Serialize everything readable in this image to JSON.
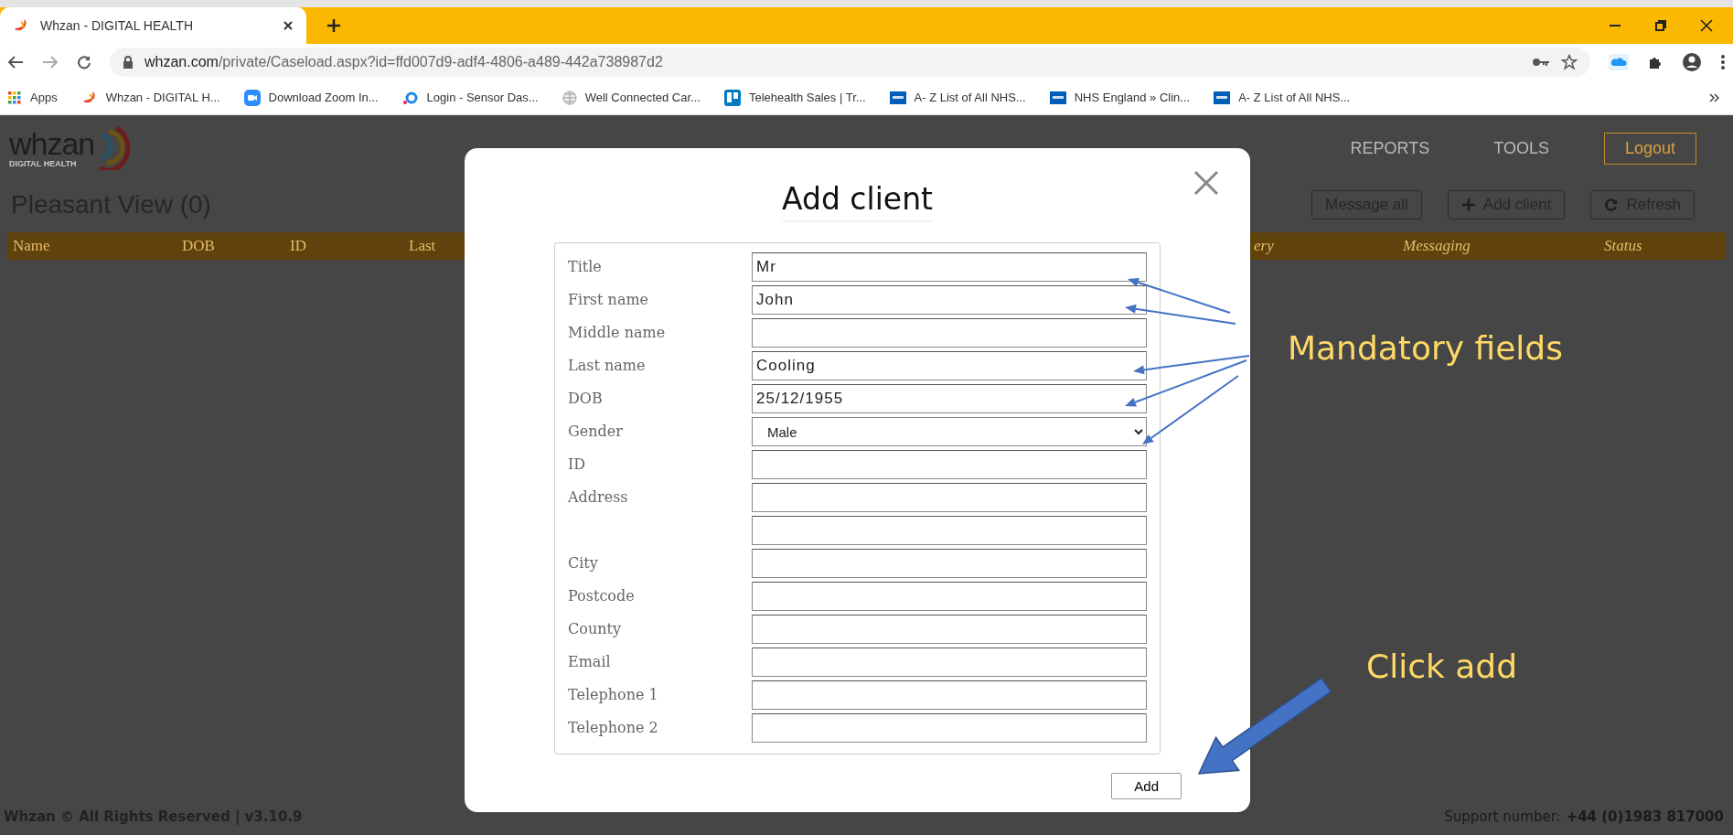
{
  "browser": {
    "tab_title": "Whzan - DIGITAL HEALTH",
    "url_host": "whzan.com",
    "url_path": "/private/Caseload.aspx?id=ffd007d9-adf4-4806-a489-442a738987d2",
    "bookmarks": [
      {
        "kind": "apps",
        "label": "Apps"
      },
      {
        "kind": "whzan",
        "label": "Whzan - DIGITAL H..."
      },
      {
        "kind": "zoom",
        "label": "Download Zoom In..."
      },
      {
        "kind": "sensor",
        "label": "Login - Sensor Das..."
      },
      {
        "kind": "globe",
        "label": "Well Connected Car..."
      },
      {
        "kind": "board",
        "label": "Telehealth Sales | Tr..."
      },
      {
        "kind": "nhs",
        "label": "A- Z List of All NHS..."
      },
      {
        "kind": "nhs",
        "label": "NHS England » Clin..."
      },
      {
        "kind": "nhs",
        "label": "A- Z List of All NHS..."
      }
    ]
  },
  "app": {
    "logo": "whzan",
    "logo_sub": "DIGITAL HEALTH",
    "nav": [
      "REPORTS",
      "TOOLS"
    ],
    "logout": "Logout",
    "page_title": "Pleasant View (0)",
    "actions": [
      {
        "kind": "plain",
        "label": "Message all"
      },
      {
        "kind": "add",
        "label": "Add client"
      },
      {
        "kind": "refresh",
        "label": "Refresh"
      }
    ],
    "columns": [
      {
        "label": "Name",
        "italic": false
      },
      {
        "label": "DOB",
        "italic": false
      },
      {
        "label": "ID",
        "italic": false
      },
      {
        "label": "Last",
        "italic": false
      },
      {
        "label": "ery",
        "italic": true
      },
      {
        "label": "Messaging",
        "italic": true
      },
      {
        "label": "Status",
        "italic": true
      }
    ],
    "footer_left": "Whzan © All Rights Reserved | v3.10.9",
    "footer_support_label": "Support number:",
    "footer_support_number": "+44 (0)1983 817000"
  },
  "modal": {
    "title": "Add client",
    "submit": "Add",
    "fields": [
      {
        "label": "Title",
        "kind": "text",
        "value": "Mr"
      },
      {
        "label": "First name",
        "kind": "text",
        "value": "John"
      },
      {
        "label": "Middle name",
        "kind": "text"
      },
      {
        "label": "Last name",
        "kind": "text",
        "value": "Cooling"
      },
      {
        "label": "DOB",
        "kind": "text",
        "value": "25/12/1955"
      },
      {
        "label": "Gender",
        "kind": "select",
        "value": "Male"
      },
      {
        "label": "ID",
        "kind": "text"
      },
      {
        "label": "Address",
        "kind": "text"
      },
      {
        "kind": "text"
      },
      {
        "label": "City",
        "kind": "text"
      },
      {
        "label": "Postcode",
        "kind": "text"
      },
      {
        "label": "County",
        "kind": "text"
      },
      {
        "label": "Email",
        "kind": "text"
      },
      {
        "label": "Telephone 1",
        "kind": "text"
      },
      {
        "label": "Telephone 2",
        "kind": "text"
      }
    ]
  },
  "annotations": [
    {
      "kind": "thin",
      "text": "Mandatory fields"
    },
    {
      "kind": "block",
      "text": "Click add"
    }
  ]
}
